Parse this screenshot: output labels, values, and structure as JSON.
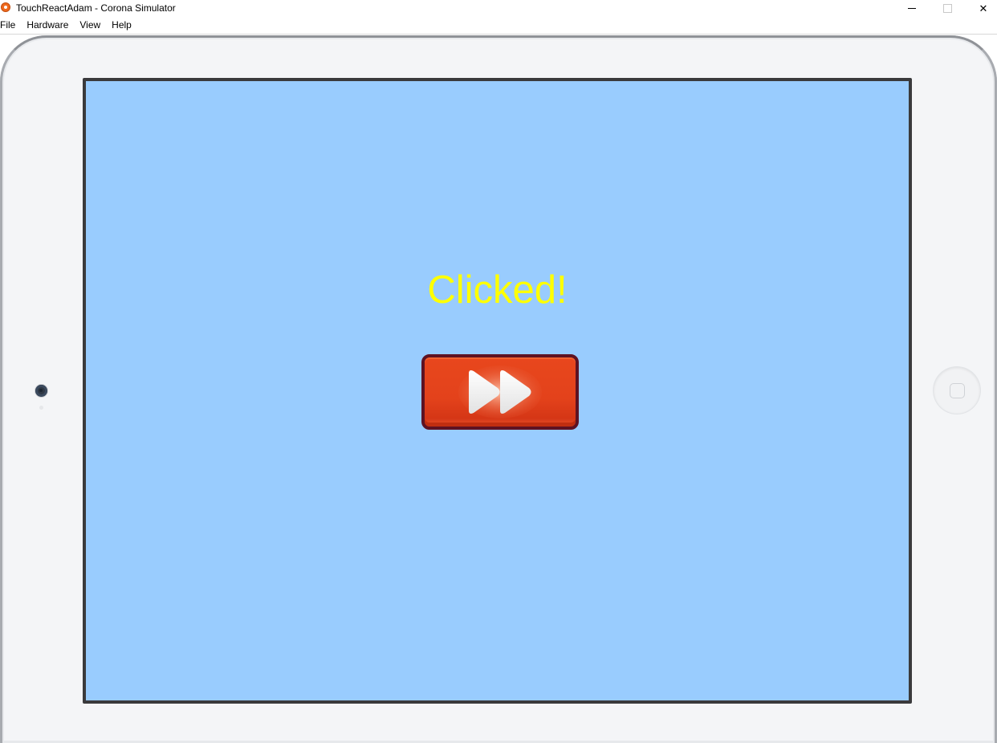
{
  "window": {
    "title": "TouchReactAdam - Corona Simulator",
    "minimize_icon": "minimize-icon",
    "maximize_icon": "maximize-icon",
    "close_icon": "close-icon",
    "close_glyph": "✕"
  },
  "menu": {
    "items": [
      "File",
      "Hardware",
      "View",
      "Help"
    ]
  },
  "screen": {
    "background": "#99ccfe",
    "message": "Clicked!",
    "message_color": "#ffff00",
    "button_icon": "fast-forward-icon",
    "button_color": "#e3421b"
  }
}
